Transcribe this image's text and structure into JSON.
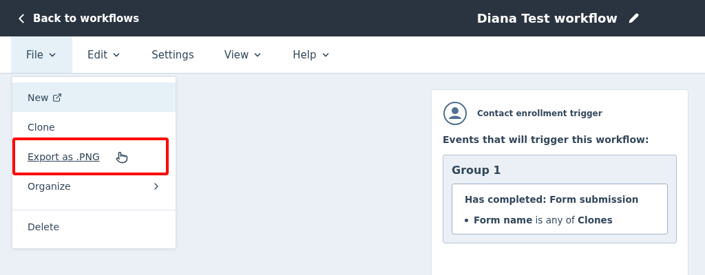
{
  "header": {
    "back_link": "Back to workflows",
    "title": "Diana Test workflow"
  },
  "menubar": [
    {
      "label": "File",
      "dropdown": true,
      "selected": true
    },
    {
      "label": "Edit",
      "dropdown": true,
      "selected": false
    },
    {
      "label": "Settings",
      "dropdown": false,
      "selected": false
    },
    {
      "label": "View",
      "dropdown": true,
      "selected": false
    },
    {
      "label": "Help",
      "dropdown": true,
      "selected": false
    }
  ],
  "file_menu": [
    {
      "label": "New",
      "kind": "external",
      "hovered": false,
      "focused": true,
      "highlighted": false
    },
    {
      "label": "Clone",
      "kind": "plain",
      "hovered": false,
      "focused": false,
      "highlighted": false
    },
    {
      "label": "Export as .PNG",
      "kind": "plain",
      "hovered": true,
      "focused": false,
      "highlighted": true
    },
    {
      "label": "Organize",
      "kind": "submenu",
      "hovered": false,
      "focused": false,
      "highlighted": false
    },
    {
      "label": "Delete",
      "kind": "separated",
      "hovered": false,
      "focused": false,
      "highlighted": false
    }
  ],
  "trigger_card": {
    "type": "Contact enrollment trigger",
    "heading": "Events that will trigger this workflow:",
    "group": {
      "title": "Group 1",
      "condition": {
        "title": "Has completed: Form submission",
        "filters": [
          "**Form name** is any of **Clones**"
        ]
      }
    }
  }
}
